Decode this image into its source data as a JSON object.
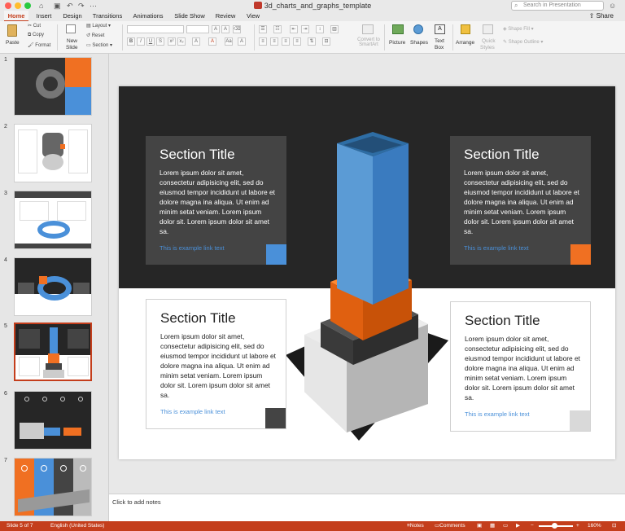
{
  "window": {
    "title": "3d_charts_and_graphs_template",
    "search_placeholder": "Search in Presentation",
    "share_label": "Share"
  },
  "tabs": [
    "Home",
    "Insert",
    "Design",
    "Transitions",
    "Animations",
    "Slide Show",
    "Review",
    "View"
  ],
  "ribbon": {
    "paste": "Paste",
    "cut": "Cut",
    "copy": "Copy",
    "format": "Format",
    "new_slide_1": "New",
    "new_slide_2": "Slide",
    "layout": "Layout",
    "reset": "Reset",
    "section": "Section",
    "convert_1": "Convert to",
    "convert_2": "SmartArt",
    "picture": "Picture",
    "shapes": "Shapes",
    "textbox_1": "Text",
    "textbox_2": "Box",
    "arrange": "Arrange",
    "quick_styles_1": "Quick",
    "quick_styles_2": "Styles",
    "shape_fill": "Shape Fill",
    "shape_outline": "Shape Outline"
  },
  "thumbnails": [
    "1",
    "2",
    "3",
    "4",
    "5",
    "6",
    "7"
  ],
  "slide": {
    "boxes": [
      {
        "title": "Section Title",
        "body": "Lorem ipsum dolor sit amet, consectetur adipisicing elit, sed do eiusmod tempor incididunt ut labore et dolore magna ina aliqua. Ut enim ad minim setat veniam. Lorem ipsum dolor sit. Lorem ipsum dolor sit amet sa.",
        "link": "This is example link text"
      },
      {
        "title": "Section Title",
        "body": "Lorem ipsum dolor sit amet, consectetur adipisicing elit, sed do eiusmod tempor incididunt ut labore et dolore magna ina aliqua. Ut enim ad minim setat veniam. Lorem ipsum dolor sit. Lorem ipsum dolor sit amet sa.",
        "link": "This is example link text"
      },
      {
        "title": "Section Title",
        "body": "Lorem ipsum dolor sit amet, consectetur adipisicing elit, sed do eiusmod tempor incididunt ut labore et dolore magna ina aliqua. Ut enim ad minim setat veniam. Lorem ipsum dolor sit. Lorem ipsum dolor sit amet sa.",
        "link": "This is example link text"
      },
      {
        "title": "Section Title",
        "body": "Lorem ipsum dolor sit amet, consectetur adipisicing elit, sed do eiusmod tempor incididunt ut labore et dolore magna ina aliqua. Ut enim ad minim setat veniam. Lorem ipsum dolor sit. Lorem ipsum dolor sit amet sa.",
        "link": "This is example link text"
      }
    ],
    "accent_colors": {
      "blue": "#4a90d9",
      "orange": "#f07022",
      "dark": "#444444",
      "light": "#d9d9d9"
    }
  },
  "notes_placeholder": "Click to add notes",
  "status": {
    "slide": "Slide 5 of 7",
    "language": "English (United States)",
    "notes": "Notes",
    "comments": "Comments",
    "zoom": "160%"
  },
  "colors": {
    "accent": "#c43e1c"
  }
}
